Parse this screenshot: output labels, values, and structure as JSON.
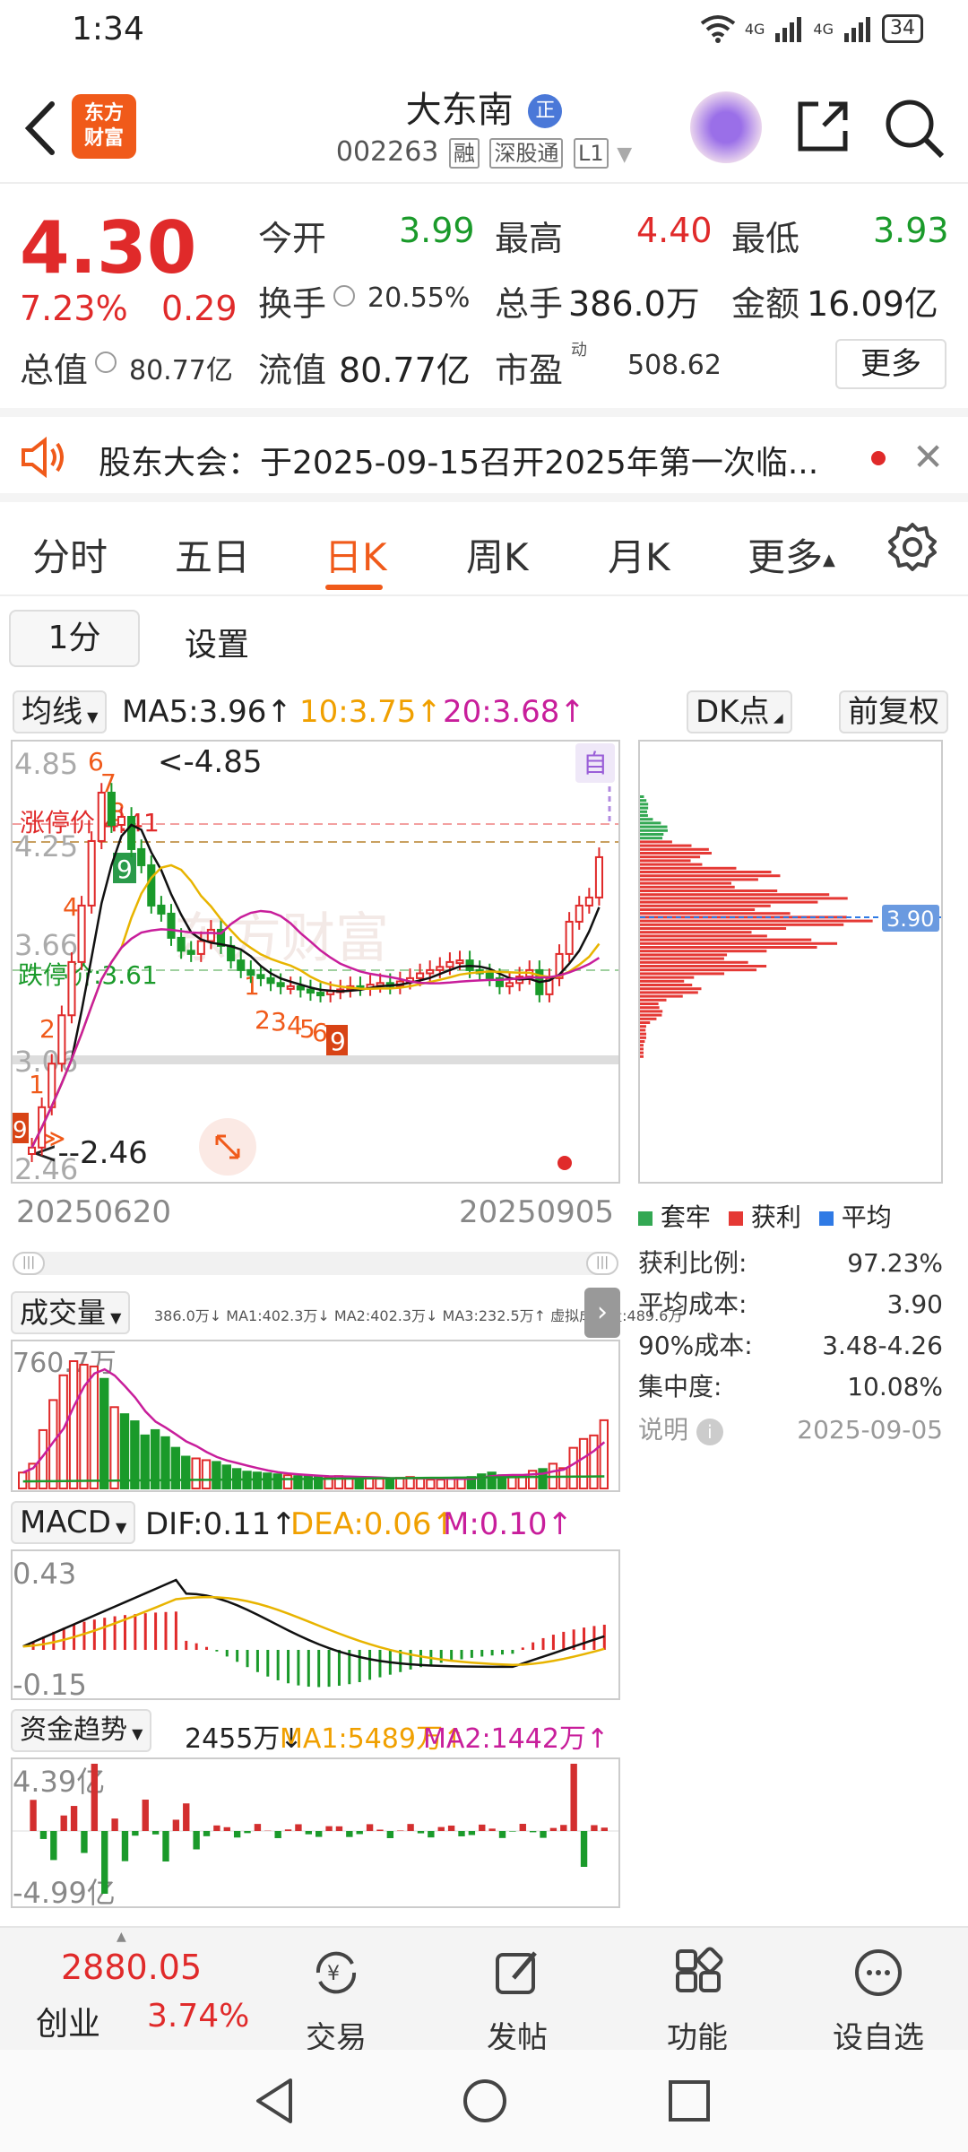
{
  "status_bar": {
    "time": "1:34",
    "network": "4G",
    "network2": "4G",
    "battery": "34"
  },
  "header": {
    "logo_text_1": "东方",
    "logo_text_2": "财富",
    "stock_name": "大东南",
    "name_badge": "正",
    "stock_code": "002263",
    "tags": [
      "融",
      "深股通",
      "L1"
    ]
  },
  "quote": {
    "price": "4.30",
    "change_pct": "7.23%",
    "change": "0.29",
    "open_label": "今开",
    "open": "3.99",
    "high_label": "最高",
    "high": "4.40",
    "low_label": "最低",
    "low": "3.93",
    "turnover_label": "换手",
    "turnover": "20.55%",
    "volume_label": "总手",
    "volume": "386.0万",
    "amount_label": "金额",
    "amount": "16.09亿",
    "total_cap_label": "总值",
    "total_cap": "80.77亿",
    "float_cap_label": "流值",
    "float_cap": "80.77亿",
    "pe_label": "市盈",
    "pe_sup": "动",
    "pe": "508.62",
    "more_label": "更多",
    "colors": {
      "up": "#e02a2a",
      "down": "#1a9a2a"
    }
  },
  "notice": {
    "text": "股东大会：于2025-09-15召开2025年第一次临..."
  },
  "tabs": [
    {
      "label": "分时"
    },
    {
      "label": "五日"
    },
    {
      "label": "日K",
      "active": true
    },
    {
      "label": "周K"
    },
    {
      "label": "月K"
    },
    {
      "label": "更多"
    }
  ],
  "period": {
    "button": "1分",
    "setting": "设置"
  },
  "ma_row": {
    "ma_selector": "均线",
    "ma5": "MA5:3.96↑",
    "ma10": "10:3.75↑",
    "ma20": "20:3.68↑",
    "dk_label": "DK点",
    "adjust_label": "前复权"
  },
  "kline": {
    "y_labels": [
      "4.85",
      "4.25",
      "3.66",
      "3.06",
      "2.46"
    ],
    "high_marker": "<-4.85",
    "low_marker": "<--2.46",
    "limit_up_label": "涨停价:4.41",
    "limit_down_label": "跌停价:3.61",
    "self_marker": "自",
    "start_date": "20250620",
    "end_date": "20250905",
    "watermark": "东方财富",
    "count_tags": [
      "6",
      "7",
      "8",
      "9",
      "4",
      "1",
      "2",
      "1",
      "9",
      "1",
      "2",
      "3",
      "4",
      "5",
      "6",
      "7",
      "8",
      "9"
    ]
  },
  "chips": {
    "avg_price": "3.90",
    "legend": [
      {
        "label": "套牢",
        "color": "#33a853"
      },
      {
        "label": "获利",
        "color": "#e53935"
      },
      {
        "label": "平均",
        "color": "#2f7ae5"
      }
    ],
    "stats": [
      {
        "label": "获利比例:",
        "value": "97.23%"
      },
      {
        "label": "平均成本:",
        "value": "3.90"
      },
      {
        "label": "90%成本:",
        "value": "3.48-4.26"
      },
      {
        "label": "集中度:",
        "value": "10.08%"
      }
    ],
    "note_label": "说明",
    "note_date": "2025-09-05"
  },
  "volume": {
    "selector": "成交量",
    "legend": "386.0万↓ MA1:402.3万↓ MA2:402.3万↓ MA3:232.5万↑ 虚拟成交量:489.6万",
    "y_label": "760.7万"
  },
  "macd": {
    "selector": "MACD",
    "dif": "DIF:0.11↑",
    "dea": "DEA:0.06↑",
    "m": "M:0.10↑",
    "y_top": "0.43",
    "y_bottom": "-0.15"
  },
  "fund": {
    "selector": "资金趋势",
    "value": "2455万↓",
    "ma1": "MA1:5489万↑",
    "ma2": "MA2:1442万↑",
    "y_top": "4.39亿",
    "y_bottom": "-4.99亿"
  },
  "bottom_bar": {
    "index_value": "2880.05",
    "index_name": "创业",
    "index_pct": "3.74%",
    "items": [
      {
        "label": "交易",
        "icon": "trade-icon"
      },
      {
        "label": "发帖",
        "icon": "post-icon"
      },
      {
        "label": "功能",
        "icon": "function-icon"
      },
      {
        "label": "设自选",
        "icon": "watchlist-icon"
      }
    ]
  },
  "chart_data": [
    {
      "type": "bar",
      "title": "成交量",
      "ylim": [
        0,
        760.7
      ],
      "series": [
        {
          "name": "成交量",
          "values": [
            90,
            140,
            330,
            500,
            640,
            720,
            700,
            690,
            620,
            460,
            420,
            380,
            300,
            330,
            290,
            230,
            180,
            170,
            160,
            150,
            130,
            110,
            95,
            90,
            85,
            80,
            75,
            70,
            70,
            65,
            65,
            70,
            65,
            60,
            60,
            55,
            55,
            60,
            65,
            55,
            50,
            50,
            55,
            60,
            65,
            80,
            90,
            75,
            70,
            65,
            100,
            110,
            140,
            115,
            230,
            280,
            300,
            386
          ]
        }
      ]
    }
  ]
}
